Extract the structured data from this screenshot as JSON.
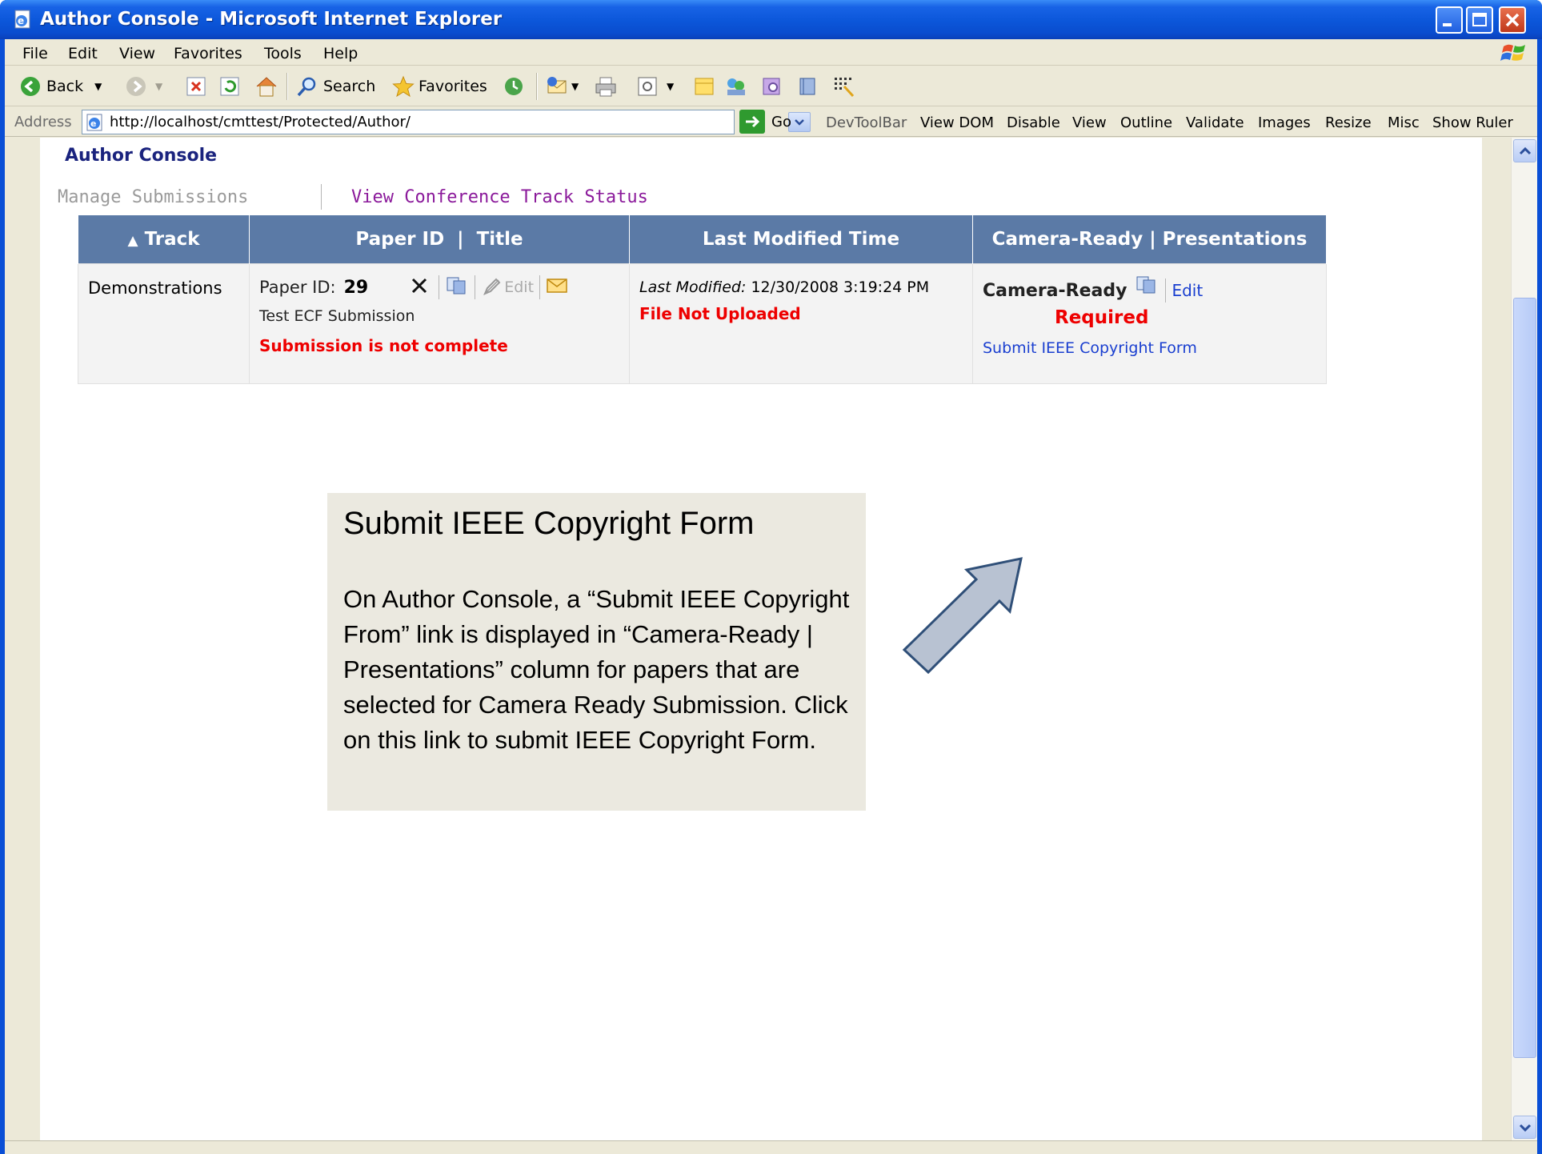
{
  "window": {
    "title": "Author Console - Microsoft Internet Explorer"
  },
  "menubar": {
    "items": [
      "File",
      "Edit",
      "View",
      "Favorites",
      "Tools",
      "Help"
    ]
  },
  "toolbar": {
    "back_label": "Back",
    "search_label": "Search",
    "favorites_label": "Favorites"
  },
  "address": {
    "label": "Address",
    "url": "http://localhost/cmttest/Protected/Author/",
    "go_label": "Go",
    "devtools": [
      "DevToolBar",
      "View DOM",
      "Disable",
      "View",
      "Outline",
      "Validate",
      "Images",
      "Resize",
      "Misc",
      "Show Ruler"
    ]
  },
  "page": {
    "console_title": "Author Console",
    "nav": {
      "manage": "Manage Submissions",
      "view_status": "View Conference Track Status"
    },
    "table": {
      "headers": {
        "track": "Track",
        "paper": "Paper ID  |  Title",
        "modified": "Last Modified Time",
        "camera": "Camera-Ready | Presentations"
      },
      "rows": [
        {
          "track": "Demonstrations",
          "paper_id_label": "Paper ID:",
          "paper_id": "29",
          "edit_label": "Edit",
          "title": "Test ECF Submission",
          "status": "Submission is not complete",
          "modified_label": "Last Modified:",
          "modified_value": "12/30/2008 3:19:24 PM",
          "file_status": "File Not Uploaded",
          "camera_label": "Camera-Ready",
          "camera_edit": "Edit",
          "camera_required": "Required",
          "copyright_link": "Submit IEEE Copyright Form"
        }
      ]
    }
  },
  "callout": {
    "title": "Submit IEEE Copyright Form",
    "body": "On Author Console, a “Submit IEEE Copyright From” link is displayed in “Camera-Ready | Presentations” column for papers that are selected for Camera Ready Submission. Click on this link to submit IEEE Copyright Form."
  },
  "colors": {
    "titlebar": "#0b56d9",
    "header_bg": "#5b7aa6",
    "error_red": "#e00000",
    "link_blue": "#1a3fd0",
    "visited_purple": "#8b1a9b",
    "callout_bg": "#ebe9e0",
    "arrow_fill": "#b8c2d2",
    "arrow_stroke": "#2f4f78"
  },
  "icons": [
    "ie-page-icon",
    "minimize-icon",
    "maximize-icon",
    "close-icon",
    "back-arrow-icon",
    "forward-arrow-icon",
    "stop-icon",
    "refresh-icon",
    "home-icon",
    "search-icon",
    "favorites-star-icon",
    "history-icon",
    "mail-icon",
    "print-icon",
    "edit-icon",
    "discuss-icon",
    "messenger-icon",
    "research-icon",
    "delete-x-icon",
    "document-icon",
    "pencil-icon",
    "envelope-icon",
    "callout-arrow-icon"
  ]
}
